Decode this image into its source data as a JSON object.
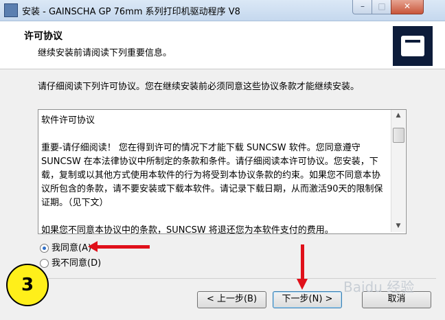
{
  "window": {
    "title": "安装 - GAINSCHA GP 76mm 系列打印机驱动程序 V8",
    "minimize_label": "–",
    "maximize_label": "□",
    "close_label": "✕"
  },
  "header": {
    "title": "许可协议",
    "subtitle": "继续安装前请阅读下列重要信息。"
  },
  "body": {
    "intro": "请仔细阅读下列许可协议。您在继续安装前必须同意这些协议条款才能继续安装。",
    "license_title": "软件许可协议",
    "license_text": "重要-请仔细阅读！ 您在得到许可的情况下才能下载 SUNCSW 软件。您同意遵守 SUNCSW 在本法律协议中所制定的条款和条件。请仔细阅读本许可协议。您安装，下载，复制或以其他方式使用本软件的行为将受到本协议条款的约束。如果您不同意本协议所包含的条款，请不要安装或下载本软件。请记录下载日期，从而激活90天的限制保证期。（见下文）",
    "license_partial_line": "如果您不同意本协议中的条款，SUNCSW 将退还您为本软件支付的费用。"
  },
  "options": {
    "accept_label": "我同意(A)",
    "decline_label": "我不同意(D)",
    "selected": "accept"
  },
  "buttons": {
    "back_label": "< 上一步(B)",
    "next_label": "下一步(N) >",
    "cancel_label": "取消"
  },
  "annotation": {
    "step_number": "3",
    "watermark": "Baidu 经验"
  },
  "colors": {
    "annotation_red": "#e0101a",
    "badge_yellow": "#ffef1a"
  }
}
